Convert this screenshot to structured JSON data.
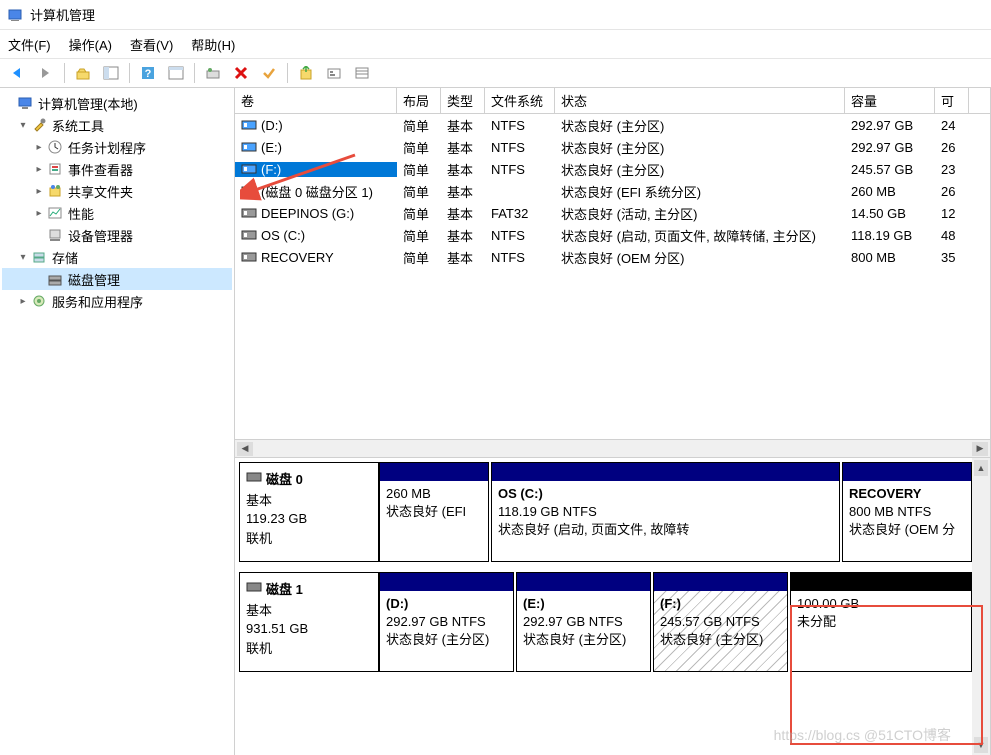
{
  "window": {
    "title": "计算机管理"
  },
  "menu": {
    "file": "文件(F)",
    "action": "操作(A)",
    "view": "查看(V)",
    "help": "帮助(H)"
  },
  "tree": {
    "root": "计算机管理(本地)",
    "system_tools": "系统工具",
    "task_scheduler": "任务计划程序",
    "event_viewer": "事件查看器",
    "shared_folders": "共享文件夹",
    "performance": "性能",
    "device_manager": "设备管理器",
    "storage": "存储",
    "disk_management": "磁盘管理",
    "services_apps": "服务和应用程序"
  },
  "columns": {
    "volume": "卷",
    "layout": "布局",
    "type": "类型",
    "fs": "文件系统",
    "status": "状态",
    "capacity": "容量",
    "free": "可"
  },
  "rows": [
    {
      "icon": "disk-blue",
      "name": "(D:)",
      "layout": "简单",
      "type": "基本",
      "fs": "NTFS",
      "status": "状态良好 (主分区)",
      "capacity": "292.97 GB",
      "free": "24",
      "selected": false
    },
    {
      "icon": "disk-blue",
      "name": "(E:)",
      "layout": "简单",
      "type": "基本",
      "fs": "NTFS",
      "status": "状态良好 (主分区)",
      "capacity": "292.97 GB",
      "free": "26",
      "selected": false
    },
    {
      "icon": "disk-blue",
      "name": "(F:)",
      "layout": "简单",
      "type": "基本",
      "fs": "NTFS",
      "status": "状态良好 (主分区)",
      "capacity": "245.57 GB",
      "free": "23",
      "selected": true
    },
    {
      "icon": "disk-blue",
      "name": "(磁盘 0 磁盘分区 1)",
      "layout": "简单",
      "type": "基本",
      "fs": "",
      "status": "状态良好 (EFI 系统分区)",
      "capacity": "260 MB",
      "free": "26",
      "selected": false
    },
    {
      "icon": "disk-gray",
      "name": "DEEPINOS (G:)",
      "layout": "简单",
      "type": "基本",
      "fs": "FAT32",
      "status": "状态良好 (活动, 主分区)",
      "capacity": "14.50 GB",
      "free": "12",
      "selected": false
    },
    {
      "icon": "disk-gray",
      "name": "OS (C:)",
      "layout": "简单",
      "type": "基本",
      "fs": "NTFS",
      "status": "状态良好 (启动, 页面文件, 故障转储, 主分区)",
      "capacity": "118.19 GB",
      "free": "48",
      "selected": false
    },
    {
      "icon": "disk-gray",
      "name": "RECOVERY",
      "layout": "简单",
      "type": "基本",
      "fs": "NTFS",
      "status": "状态良好 (OEM 分区)",
      "capacity": "800 MB",
      "free": "35",
      "selected": false
    }
  ],
  "disks": {
    "d0": {
      "title": "磁盘 0",
      "type": "基本",
      "size": "119.23 GB",
      "state": "联机",
      "p1": {
        "line1": "260 MB",
        "line2": "状态良好 (EFI"
      },
      "p2": {
        "name": "OS  (C:)",
        "line1": "118.19 GB NTFS",
        "line2": "状态良好 (启动, 页面文件, 故障转"
      },
      "p3": {
        "name": "RECOVERY",
        "line1": "800 MB NTFS",
        "line2": "状态良好 (OEM 分"
      }
    },
    "d1": {
      "title": "磁盘 1",
      "type": "基本",
      "size": "931.51 GB",
      "state": "联机",
      "p1": {
        "name": "(D:)",
        "line1": "292.97 GB NTFS",
        "line2": "状态良好 (主分区)"
      },
      "p2": {
        "name": "(E:)",
        "line1": "292.97 GB NTFS",
        "line2": "状态良好 (主分区)"
      },
      "p3": {
        "name": "(F:)",
        "line1": "245.57 GB NTFS",
        "line2": "状态良好 (主分区)"
      },
      "p4": {
        "line1": "100.00 GB",
        "line2": "未分配"
      }
    }
  },
  "watermark": "https://blog.cs @51CTO博客"
}
